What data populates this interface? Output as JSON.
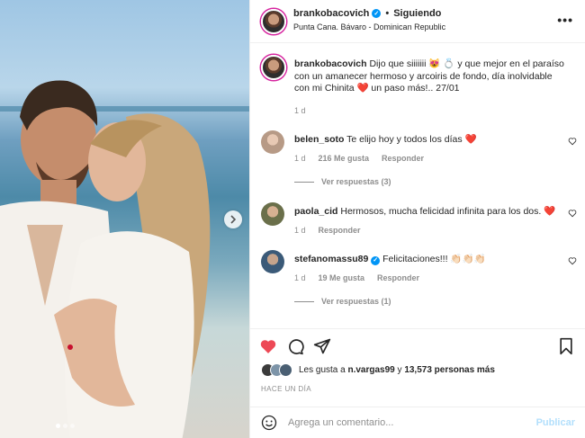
{
  "header": {
    "username": "brankobacovich",
    "separator": "•",
    "follow_label": "Siguiendo",
    "location": "Punta Cana. Bávaro - Dominican Republic",
    "more_icon": "more-horizontal-icon"
  },
  "caption": {
    "username": "brankobacovich",
    "text": "Dijo que siiiiiii 😻 💍 y que mejor en el paraíso con un amanecer hermoso y arcoiris de fondo, día inolvidable con mi Chinita ❤️ un paso más!.. 27/01",
    "age": "1 d"
  },
  "comments": [
    {
      "username": "belen_soto",
      "text": "Te elijo hoy y todos los días ❤️",
      "age": "1 d",
      "likes": "216 Me gusta",
      "reply": "Responder",
      "replies_label": "Ver respuestas (3)",
      "avatar_color": "#b79a86"
    },
    {
      "username": "paola_cid",
      "text": "Hermosos, mucha felicidad infinita para los dos. ❤️",
      "age": "1 d",
      "reply": "Responder",
      "avatar_color": "#6a6f4a"
    },
    {
      "username": "stefanomassu89",
      "text": "Felicitaciones!!! 👏🏻👏🏻👏🏻",
      "age": "1 d",
      "likes": "19 Me gusta",
      "reply": "Responder",
      "replies_label": "Ver respuestas (1)",
      "avatar_color": "#3b5a78"
    }
  ],
  "likes": {
    "prefix": "Les gusta a ",
    "user": "n.vargas99",
    "middle": " y ",
    "count": "13,573 personas más"
  },
  "time_label": "HACE UN DÍA",
  "composer": {
    "placeholder": "Agrega un comentario...",
    "publish_label": "Publicar"
  },
  "colors": {
    "like_red": "#ed4956",
    "verified_blue": "#0095f6",
    "publish_blue": "#b2dffc"
  },
  "carousel": {
    "slides": 3,
    "active_slide": 1
  }
}
